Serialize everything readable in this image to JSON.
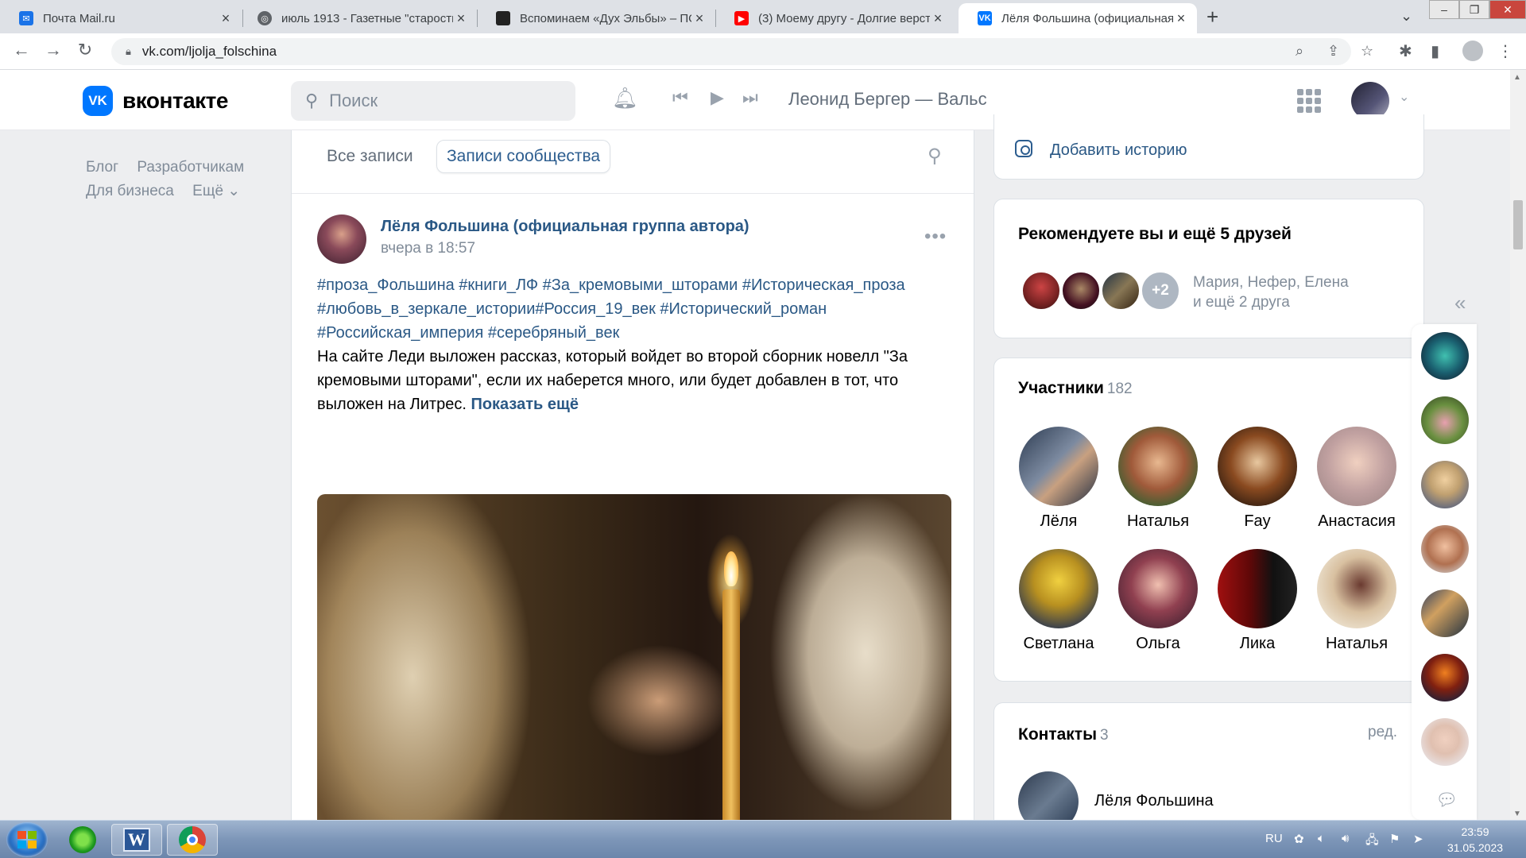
{
  "browser": {
    "tabs": [
      {
        "title": "Почта Mail.ru",
        "icon": "mail-icon"
      },
      {
        "title": "июль 1913 - Газетные \"старости\"",
        "icon": "globe-icon"
      },
      {
        "title": "Вспоминаем «Дух Эльбы» – ПО",
        "icon": "site-icon"
      },
      {
        "title": "(3) Моему другу - Долгие верст",
        "icon": "youtube-icon"
      },
      {
        "title": "Лёля Фольшина (официальная г",
        "icon": "vk-icon"
      }
    ],
    "url": "vk.com/ljolja_folschina"
  },
  "header": {
    "logo_text": "вконтакте",
    "logo_mark": "VK",
    "search_placeholder": "Поиск",
    "now_playing": "Леонид Бергер — Вальс"
  },
  "left_menu": {
    "items": [
      "Блог",
      "Разработчикам",
      "Для бизнеса",
      "Ещё ⌄"
    ]
  },
  "wall": {
    "tabs": [
      "Все записи",
      "Записи сообщества"
    ],
    "post": {
      "author": "Лёля Фольшина (официальная группа автора)",
      "date": "вчера в 18:57",
      "hashtags_line1": "#проза_Фольшина #книги_ЛФ #За_кремовыми_шторами #Историческая_проза",
      "hashtags_line2": "#любовь_в_зеркале_истории#Россия_19_век #Исторический_роман",
      "hashtags_line3": "#Российская_империя #серебряный_век",
      "text": "На сайте Леди выложен рассказ, который войдет во второй сборник новелл \"За кремовыми шторами\", если их наберется много, или будет добавлен в тот, что выложен на Литрес.",
      "show_more": "Показать ещё"
    }
  },
  "sidebar": {
    "add_story": "Добавить историю",
    "recommend": {
      "title": "Рекомендуете вы и ещё 5 друзей",
      "plus": "+2",
      "names_line1": "Мария, Нефер, Елена",
      "names_line2": "и ещё 2 друга"
    },
    "members": {
      "title": "Участники",
      "count": "182",
      "people": [
        "Лёля",
        "Наталья",
        "Fay",
        "Анастасия",
        "Светлана",
        "Ольга",
        "Лика",
        "Наталья"
      ]
    },
    "contacts": {
      "title": "Контакты",
      "count": "3",
      "edit": "ред.",
      "name": "Лёля Фольшина"
    }
  },
  "taskbar": {
    "lang": "RU",
    "time": "23:59",
    "date": "31.05.2023"
  },
  "colors": {
    "vk_blue": "#0077ff",
    "link": "#2a5885",
    "page_bg": "#edeef0"
  }
}
